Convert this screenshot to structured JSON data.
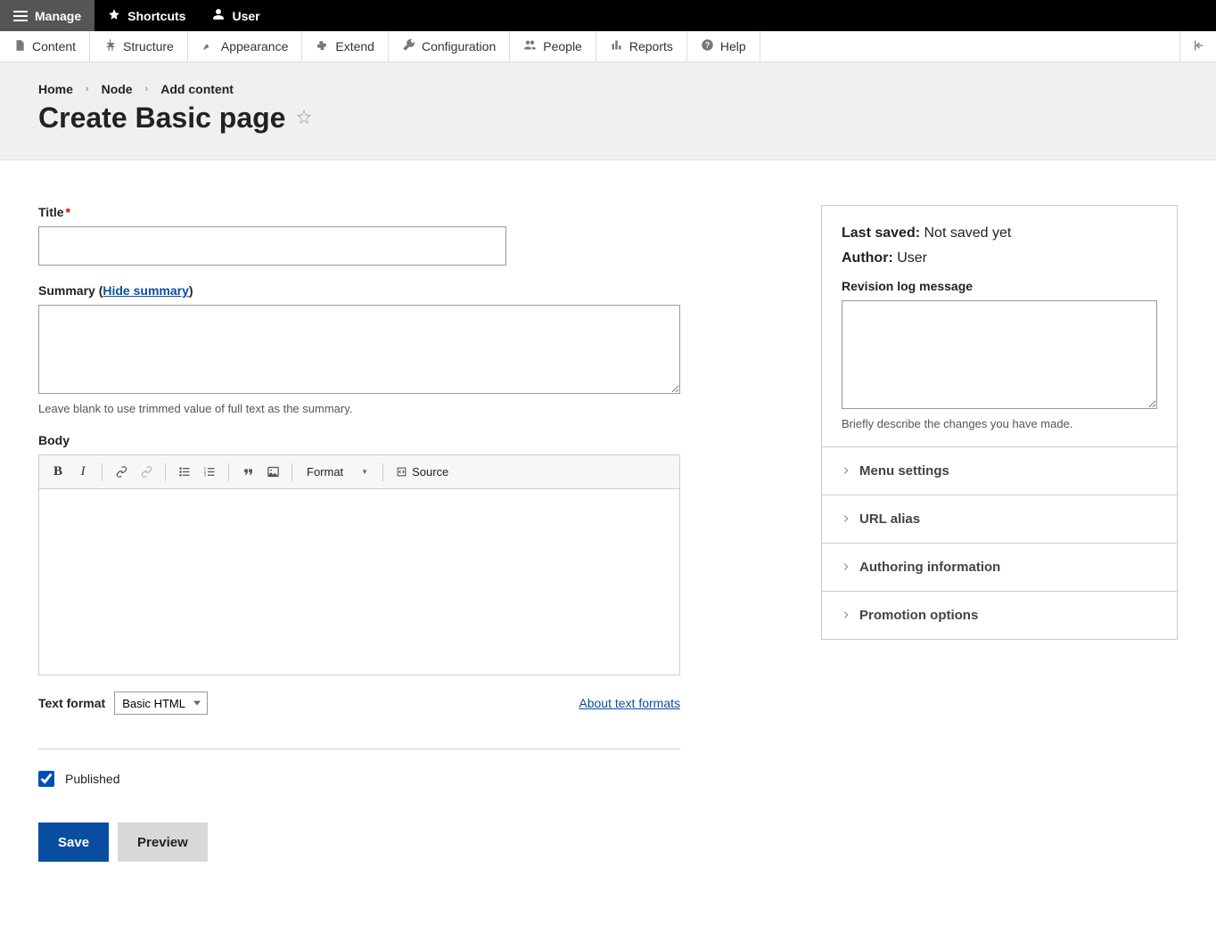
{
  "topbar": {
    "manage": "Manage",
    "shortcuts": "Shortcuts",
    "user": "User"
  },
  "toolbar": {
    "content": "Content",
    "structure": "Structure",
    "appearance": "Appearance",
    "extend": "Extend",
    "configuration": "Configuration",
    "people": "People",
    "reports": "Reports",
    "help": "Help"
  },
  "breadcrumb": {
    "home": "Home",
    "node": "Node",
    "add": "Add content"
  },
  "page_title": "Create Basic page",
  "fields": {
    "title_label": "Title",
    "summary_label": "Summary",
    "summary_toggle": "Hide summary",
    "summary_help": "Leave blank to use trimmed value of full text as the summary.",
    "body_label": "Body",
    "text_format_label": "Text format",
    "text_format_value": "Basic HTML",
    "about_link": "About text formats",
    "published_label": "Published"
  },
  "editor": {
    "format_label": "Format",
    "source_label": "Source"
  },
  "actions": {
    "save": "Save",
    "preview": "Preview"
  },
  "sidebar": {
    "last_saved_label": "Last saved:",
    "last_saved_value": "Not saved yet",
    "author_label": "Author:",
    "author_value": "User",
    "revision_label": "Revision log message",
    "revision_help": "Briefly describe the changes you have made.",
    "accordion": {
      "menu": "Menu settings",
      "url": "URL alias",
      "authoring": "Authoring information",
      "promotion": "Promotion options"
    }
  }
}
